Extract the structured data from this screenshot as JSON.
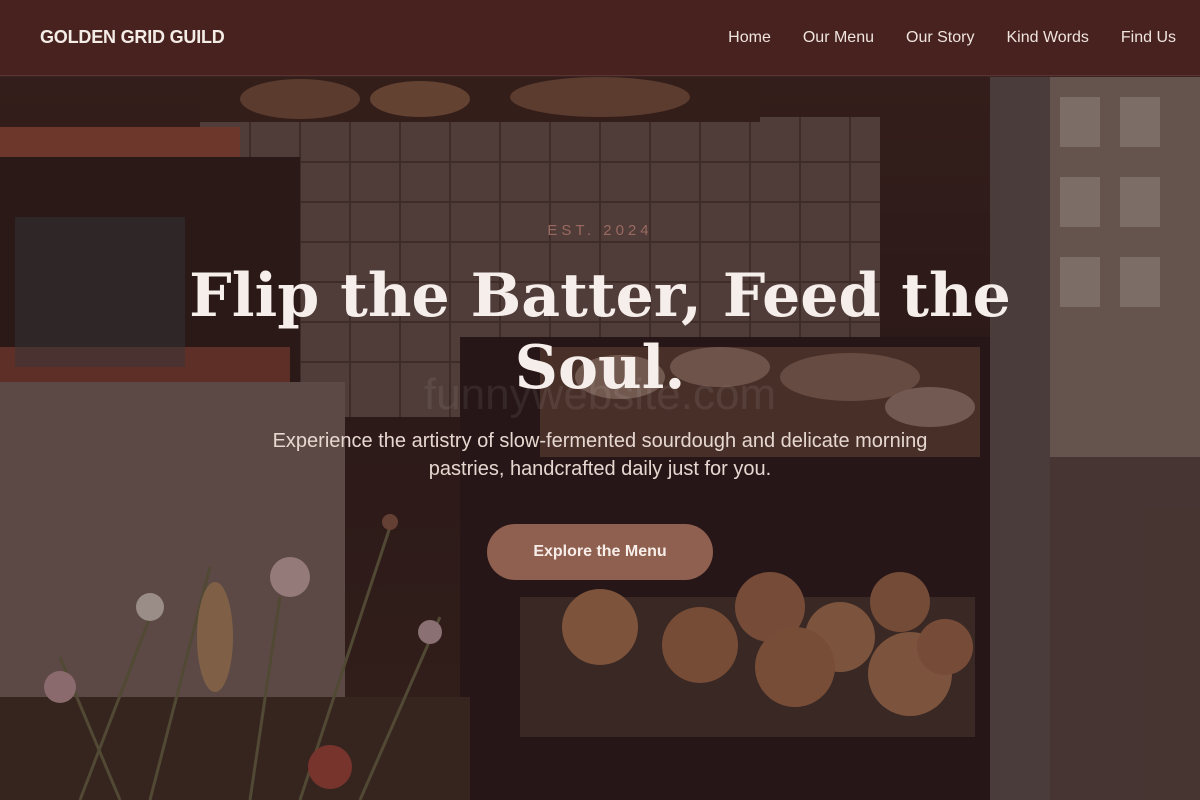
{
  "header": {
    "brand": "GOLDEN GRID GUILD",
    "nav": [
      {
        "label": "Home"
      },
      {
        "label": "Our Menu"
      },
      {
        "label": "Our Story"
      },
      {
        "label": "Kind Words"
      },
      {
        "label": "Find Us"
      }
    ]
  },
  "hero": {
    "eyebrow": "EST. 2024",
    "headline": "Flip the Batter, Feed the Soul.",
    "subtitle": "Experience the artistry of slow-fermented sourdough and delicate morning pastries, handcrafted daily just for you.",
    "cta_label": "Explore the Menu",
    "watermark": "funnywebsite.com"
  },
  "colors": {
    "header_bg": "#48221f",
    "accent": "#8f5f4f",
    "headline": "#f6eeea",
    "eyebrow": "#9a6a60"
  }
}
